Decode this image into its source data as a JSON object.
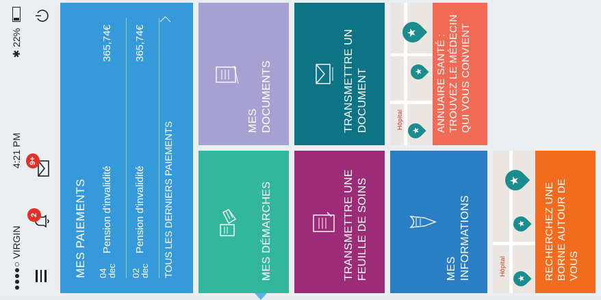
{
  "status": {
    "carrier": "●●●●○ VIRGIN",
    "time": "4:21 PM",
    "battery": "22%",
    "bluetooth_icon": "bluetooth-icon",
    "wifi_icon": "wifi-icon"
  },
  "header": {
    "notifications_badge": "2",
    "messages_badge": "9+"
  },
  "payments": {
    "title": "MES PAIEMENTS",
    "rows": [
      {
        "day": "04",
        "month": "dec",
        "label": "Pension d'invalidité",
        "amount": "365,74€"
      },
      {
        "day": "02",
        "month": "dec",
        "label": "Pension d'invalidité",
        "amount": "365,74€"
      }
    ],
    "all_link": "TOUS LES DERNIERS PAIEMENTS"
  },
  "tiles": {
    "demarches": "MES DÉMARCHES",
    "documents_1": "MES",
    "documents_2": "DOCUMENTS",
    "feuille_1": "TRANSMETTRE UNE",
    "feuille_2": "FEUILLE DE SOINS",
    "transmettre_1": "TRANSMETTRE UN",
    "transmettre_2": "DOCUMENT",
    "infos_1": "MES",
    "infos_2": "INFORMATIONS",
    "annuaire_1": "ANNUAIRE SANTÉ :",
    "annuaire_2": "TROUVEZ LE MÉDECIN",
    "annuaire_3": "QUI VOUS CONVIENT",
    "borne_1": "RECHERCHEZ UNE",
    "borne_2": "BORNE AUTOUR DE",
    "borne_3": "VOUS",
    "map_label": "Hôpital"
  },
  "colors": {
    "payments": "#3699d9",
    "demarches": "#32b79e",
    "documents": "#a7a0d2",
    "feuille": "#9c2b78",
    "transmettre": "#0f7386",
    "infos": "#2a7fc4",
    "annuaire": "#f06a55",
    "borne": "#f26b1f"
  }
}
